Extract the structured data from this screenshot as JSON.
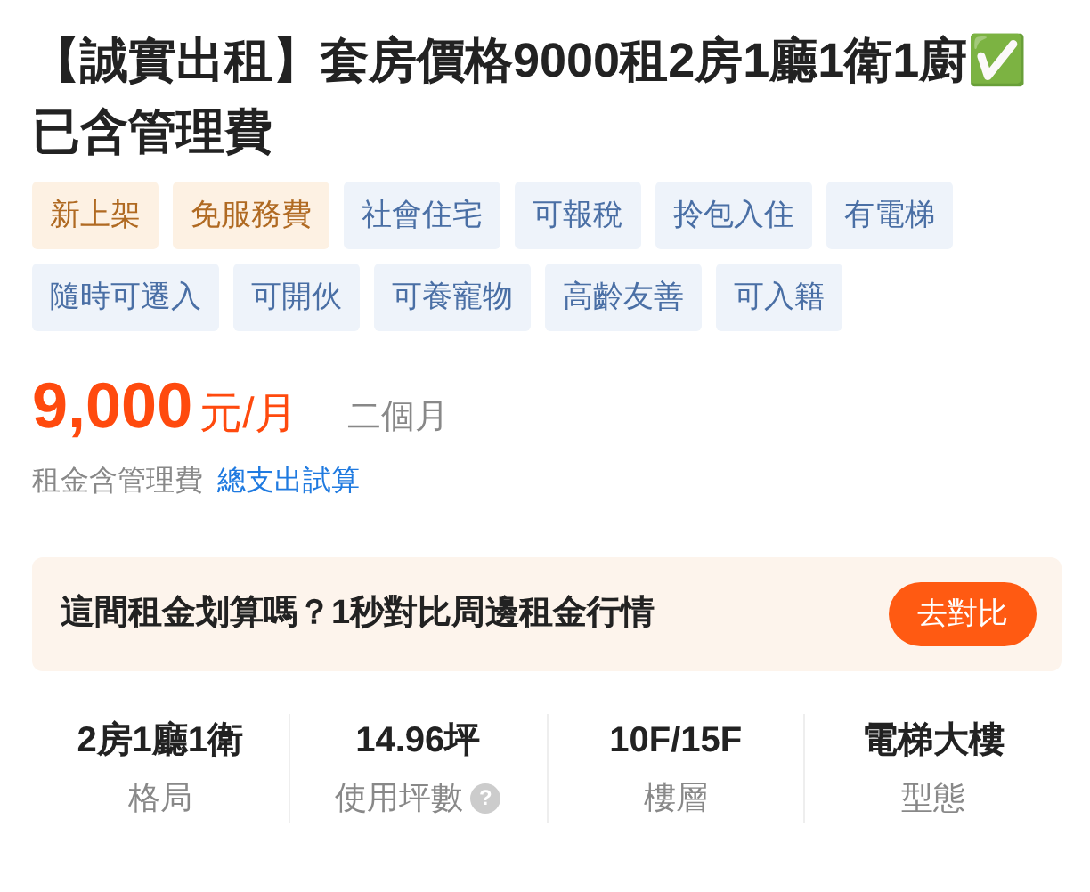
{
  "title": "【誠實出租】套房價格9000租2房1廳1衛1廚✅已含管理費",
  "tags": [
    {
      "label": "新上架",
      "kind": "promo"
    },
    {
      "label": "免服務費",
      "kind": "promo"
    },
    {
      "label": "社會住宅",
      "kind": "feature"
    },
    {
      "label": "可報稅",
      "kind": "feature"
    },
    {
      "label": "拎包入住",
      "kind": "feature"
    },
    {
      "label": "有電梯",
      "kind": "feature"
    },
    {
      "label": "隨時可遷入",
      "kind": "feature"
    },
    {
      "label": "可開伙",
      "kind": "feature"
    },
    {
      "label": "可養寵物",
      "kind": "feature"
    },
    {
      "label": "高齡友善",
      "kind": "feature"
    },
    {
      "label": "可入籍",
      "kind": "feature"
    }
  ],
  "price": {
    "amount": "9,000",
    "unit": "元/月",
    "deposit": "二個月",
    "note": "租金含管理費",
    "link": "總支出試算"
  },
  "compare": {
    "text": "這間租金划算嗎？1秒對比周邊租金行情",
    "button": "去對比"
  },
  "stats": [
    {
      "value": "2房1廳1衛",
      "label": "格局"
    },
    {
      "value": "14.96坪",
      "label": "使用坪數",
      "help": "?"
    },
    {
      "value": "10F/15F",
      "label": "樓層"
    },
    {
      "value": "電梯大樓",
      "label": "型態"
    }
  ]
}
